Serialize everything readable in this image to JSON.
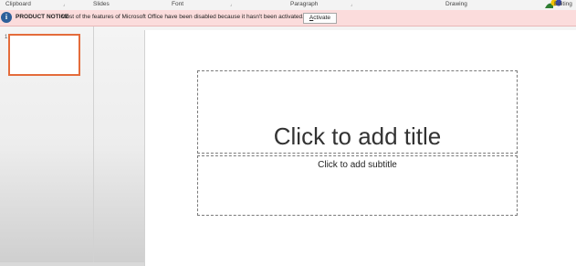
{
  "ribbon": {
    "groups": {
      "clipboard": "Clipboard",
      "slides": "Slides",
      "font": "Font",
      "paragraph": "Paragraph",
      "drawing": "Drawing",
      "editing": "Editing"
    }
  },
  "notice": {
    "title": "PRODUCT NOTICE",
    "message": "Most of the features of Microsoft Office have been disabled because it hasn't been activated.",
    "button_access_key": "A",
    "button_rest": "ctivate"
  },
  "slide": {
    "title_placeholder": "Click to add title",
    "subtitle_placeholder": "Click to add subtitle"
  },
  "thumbnails": {
    "current_slide": "1"
  },
  "colors": {
    "accent": "#e46c3b",
    "notice_bg": "#fbdcdc",
    "info_icon": "#2d5f9a"
  },
  "icons": [
    "info-icon",
    "dialog-launcher-icon",
    "drawing-shapes-icon"
  ]
}
